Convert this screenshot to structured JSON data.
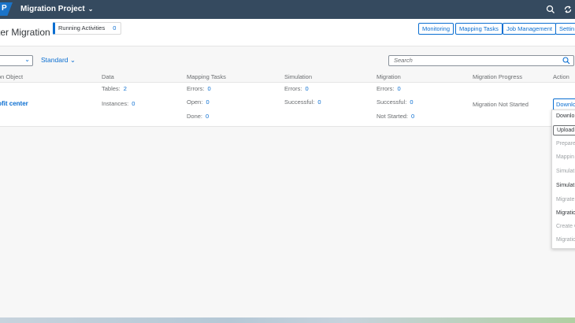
{
  "shell": {
    "logo": "P",
    "title": "Migration Project",
    "icons": [
      "search-icon",
      "sync-icon"
    ]
  },
  "header": {
    "page_title": "ter Migration",
    "running_activities": {
      "label": "Running Activities",
      "count": "0"
    },
    "buttons": [
      "Monitoring",
      "Mapping Tasks",
      "Job Management",
      "Settin"
    ]
  },
  "filter": {
    "variant": "Standard",
    "search_placeholder": "Search"
  },
  "table": {
    "columns": [
      "on Object",
      "Data",
      "Mapping Tasks",
      "Simulation",
      "Migration",
      "Migration Progress",
      "Action"
    ],
    "row": {
      "object": "rofit center",
      "data": {
        "tables_label": "Tables:",
        "tables": "2",
        "instances_label": "Instances:",
        "instances": "0"
      },
      "mapping": {
        "errors_label": "Errors:",
        "errors": "0",
        "open_label": "Open:",
        "open": "0",
        "done_label": "Done:",
        "done": "0"
      },
      "simulation": {
        "errors_label": "Errors:",
        "errors": "0",
        "successful_label": "Successful:",
        "successful": "0"
      },
      "migration": {
        "errors_label": "Errors:",
        "errors": "0",
        "successful_label": "Successful:",
        "successful": "0",
        "not_started_label": "Not Started:",
        "not_started": "0"
      },
      "progress": "Migration Not Started",
      "action": "Downlo"
    }
  },
  "action_menu": [
    {
      "label": "Downlo",
      "enabled": true
    },
    {
      "label": "Upload",
      "enabled": true
    },
    {
      "label": "Prepare",
      "enabled": false
    },
    {
      "label": "Mappin",
      "enabled": false
    },
    {
      "label": "Simulat",
      "enabled": false
    },
    {
      "label": "Simulat",
      "enabled": true
    },
    {
      "label": "Migrate",
      "enabled": false
    },
    {
      "label": "Migratio",
      "enabled": true
    },
    {
      "label": "Create C",
      "enabled": false
    },
    {
      "label": "Migratio",
      "enabled": false
    }
  ],
  "colors": {
    "shell": "#354a5f",
    "accent": "#0a6ed1",
    "text": "#32363a",
    "muted": "#6a6d70"
  }
}
